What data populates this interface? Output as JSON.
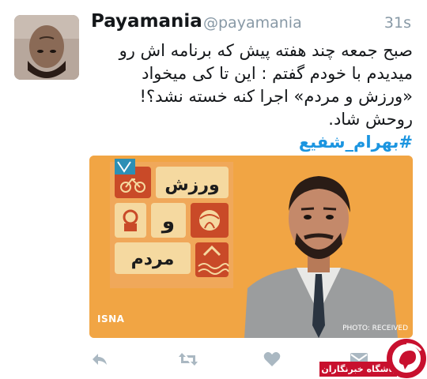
{
  "tweet": {
    "display_name": "Payamania",
    "handle": "@payamania",
    "timestamp": "31s",
    "text_lines": [
      "صبح جمعه چند هفته پیش که برنامه اش رو",
      "میدیدم با خودم گفتم : این تا کی میخواد",
      "«ورزش و مردم» اجرا کنه خسته نشد؟!",
      "روحش شاد."
    ],
    "hashtag": "#بهرام_شفیع"
  },
  "media": {
    "logo_words": [
      "ورزش",
      "و",
      "مردم"
    ],
    "watermark": "ISNA",
    "credit": "PHOTO: RECEIVED"
  },
  "actions": [
    {
      "name": "reply-icon"
    },
    {
      "name": "retweet-icon"
    },
    {
      "name": "like-icon"
    },
    {
      "name": "message-icon"
    }
  ],
  "brand": {
    "label": "باشگاه خبرنگاران",
    "accent": "#c8102e"
  },
  "colors": {
    "hashtag": "#1b95e0",
    "meta": "#8899a6",
    "media_background": "#f0a040"
  }
}
